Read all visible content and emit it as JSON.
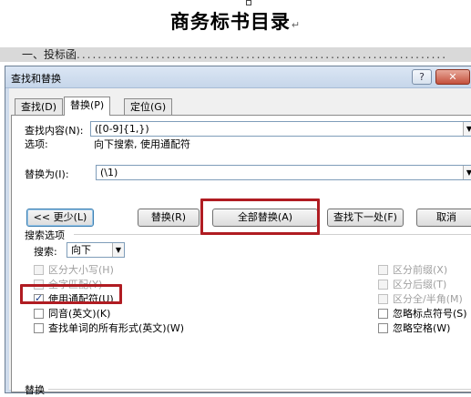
{
  "document": {
    "title": "商务标书目录",
    "para_mark": "↵",
    "toc_line": "一、投标函",
    "toc_dots": "......................................................................"
  },
  "dialog": {
    "title": "查找和替换",
    "help_label": "?",
    "close_label": "✕",
    "tabs": [
      {
        "label": "查找(D)",
        "active": false
      },
      {
        "label": "替换(P)",
        "active": true
      },
      {
        "label": "定位(G)",
        "active": false
      }
    ],
    "find": {
      "label": "查找内容(N):",
      "value": "([0-9]{1,})",
      "options_label": "选项:",
      "options_value": "向下搜索, 使用通配符"
    },
    "replace": {
      "label": "替换为(I):",
      "value": "(\\1)"
    },
    "buttons": {
      "less": "<< 更少(L)",
      "replace": "替换(R)",
      "replace_all": "全部替换(A)",
      "find_next": "查找下一处(F)",
      "cancel": "取消"
    },
    "search_options": {
      "group_label": "搜索选项",
      "search_label": "搜索:",
      "search_value": "向下",
      "left": [
        {
          "label": "区分大小写(H)",
          "checked": false,
          "disabled": true
        },
        {
          "label": "全字匹配(Y)",
          "checked": false,
          "disabled": true
        },
        {
          "label": "使用通配符(U)",
          "checked": true,
          "disabled": false
        },
        {
          "label": "同音(英文)(K)",
          "checked": false,
          "disabled": false
        },
        {
          "label": "查找单词的所有形式(英文)(W)",
          "checked": false,
          "disabled": false
        }
      ],
      "right": [
        {
          "label": "区分前缀(X)",
          "checked": false,
          "disabled": true
        },
        {
          "label": "区分后缀(T)",
          "checked": false,
          "disabled": true
        },
        {
          "label": "区分全/半角(M)",
          "checked": false,
          "disabled": true
        },
        {
          "label": "忽略标点符号(S)",
          "checked": false,
          "disabled": false
        },
        {
          "label": "忽略空格(W)",
          "checked": false,
          "disabled": false
        }
      ]
    },
    "footer_group_label": "替换",
    "highlight_color": "#b01c22"
  }
}
